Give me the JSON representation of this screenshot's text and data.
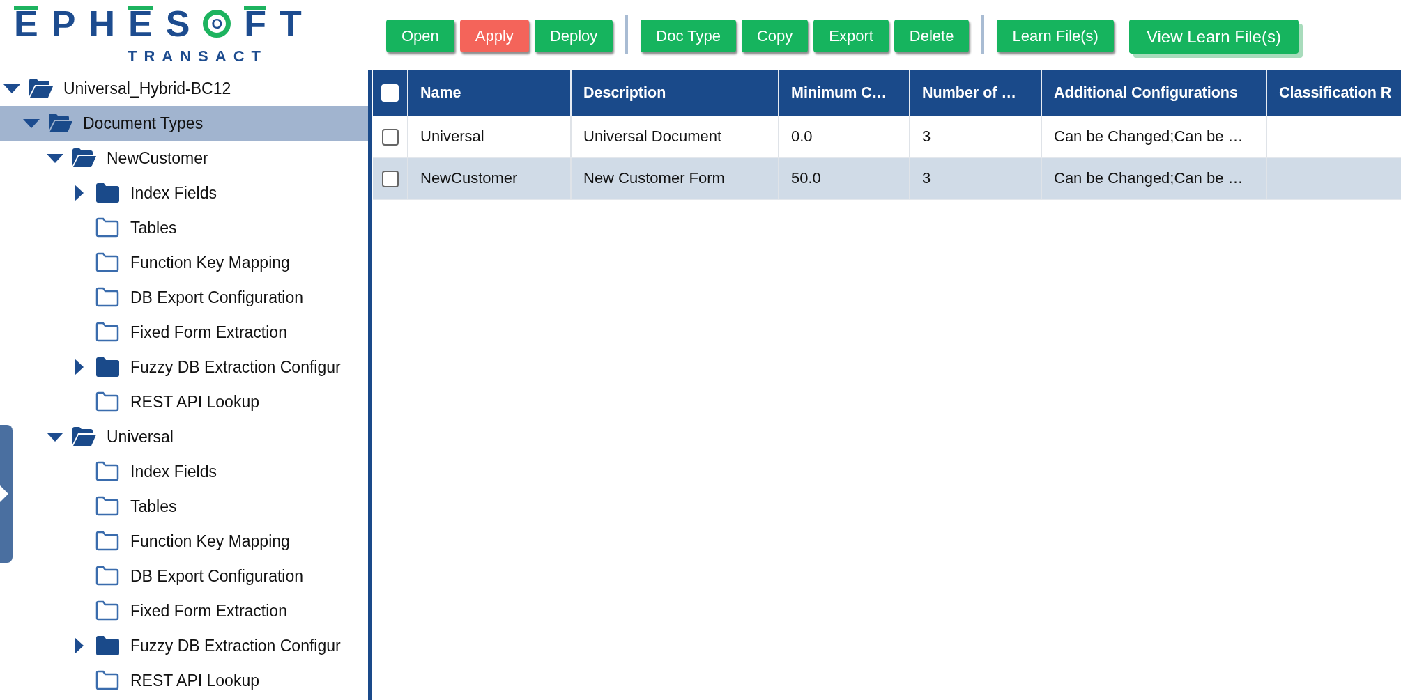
{
  "logo": {
    "wordmark": [
      "E",
      "P",
      "H",
      "E",
      "S",
      "O",
      "F",
      "T"
    ],
    "product": "TRANSACT"
  },
  "toolbar": {
    "groups": [
      [
        {
          "label": "Open",
          "kind": "normal"
        },
        {
          "label": "Apply",
          "kind": "danger"
        },
        {
          "label": "Deploy",
          "kind": "normal"
        }
      ],
      [
        {
          "label": "Doc Type",
          "kind": "normal"
        },
        {
          "label": "Copy",
          "kind": "normal"
        },
        {
          "label": "Export",
          "kind": "normal"
        },
        {
          "label": "Delete",
          "kind": "normal"
        }
      ],
      [
        {
          "label": "Learn File(s)",
          "kind": "normal"
        },
        {
          "label": "View Learn File(s)",
          "kind": "focused"
        }
      ]
    ]
  },
  "tree": {
    "items": [
      {
        "label": "Universal_Hybrid-BC12",
        "kind": "branch",
        "expanded": true,
        "selected": false,
        "children": [
          {
            "label": "Document Types",
            "kind": "branch",
            "expanded": true,
            "selected": true,
            "children": [
              {
                "label": "NewCustomer",
                "kind": "branch",
                "expanded": true,
                "selected": false,
                "children": [
                  {
                    "label": "Index Fields",
                    "kind": "branch",
                    "expanded": false,
                    "selected": false
                  },
                  {
                    "label": "Tables",
                    "kind": "leaf",
                    "selected": false
                  },
                  {
                    "label": "Function Key Mapping",
                    "kind": "leaf",
                    "selected": false
                  },
                  {
                    "label": "DB Export Configuration",
                    "kind": "leaf",
                    "selected": false
                  },
                  {
                    "label": "Fixed Form Extraction",
                    "kind": "leaf",
                    "selected": false
                  },
                  {
                    "label": "Fuzzy DB Extraction Configur",
                    "kind": "branch",
                    "expanded": false,
                    "selected": false
                  },
                  {
                    "label": "REST API Lookup",
                    "kind": "leaf",
                    "selected": false
                  }
                ]
              },
              {
                "label": "Universal",
                "kind": "branch",
                "expanded": true,
                "selected": false,
                "children": [
                  {
                    "label": "Index Fields",
                    "kind": "leaf",
                    "selected": false
                  },
                  {
                    "label": "Tables",
                    "kind": "leaf",
                    "selected": false
                  },
                  {
                    "label": "Function Key Mapping",
                    "kind": "leaf",
                    "selected": false
                  },
                  {
                    "label": "DB Export Configuration",
                    "kind": "leaf",
                    "selected": false
                  },
                  {
                    "label": "Fixed Form Extraction",
                    "kind": "leaf",
                    "selected": false
                  },
                  {
                    "label": "Fuzzy DB Extraction Configur",
                    "kind": "branch",
                    "expanded": false,
                    "selected": false
                  },
                  {
                    "label": "REST API Lookup",
                    "kind": "leaf",
                    "selected": false
                  }
                ]
              }
            ]
          }
        ]
      }
    ]
  },
  "table": {
    "select_all_checked": false,
    "columns": [
      "Name",
      "Description",
      "Minimum C…",
      "Number of …",
      "Additional Configurations",
      "Classification R"
    ],
    "rows": [
      {
        "checked": false,
        "cells": [
          "Universal",
          "Universal Document",
          "0.0",
          "3",
          "Can be Changed;Can be …",
          ""
        ]
      },
      {
        "checked": false,
        "cells": [
          "NewCustomer",
          "New Customer Form",
          "50.0",
          "3",
          "Can be Changed;Can be …",
          ""
        ]
      }
    ]
  }
}
